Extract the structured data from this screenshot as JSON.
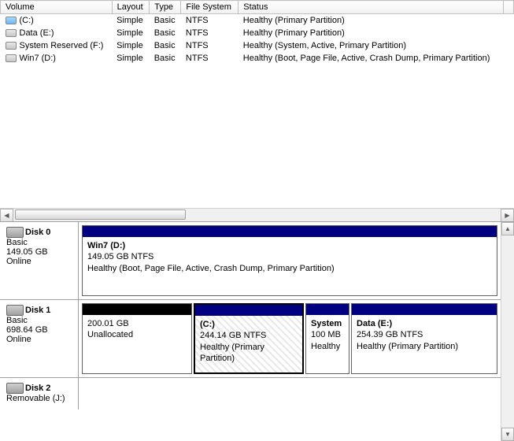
{
  "columns": {
    "c0": "Volume",
    "c1": "Layout",
    "c2": "Type",
    "c3": "File System",
    "c4": "Status"
  },
  "volumes": [
    {
      "name": "(C:)",
      "layout": "Simple",
      "type": "Basic",
      "fs": "NTFS",
      "status": "Healthy (Primary Partition)",
      "iconcls": "c-drv"
    },
    {
      "name": "Data (E:)",
      "layout": "Simple",
      "type": "Basic",
      "fs": "NTFS",
      "status": "Healthy (Primary Partition)",
      "iconcls": ""
    },
    {
      "name": "System Reserved (F:)",
      "layout": "Simple",
      "type": "Basic",
      "fs": "NTFS",
      "status": "Healthy (System, Active, Primary Partition)",
      "iconcls": ""
    },
    {
      "name": "Win7 (D:)",
      "layout": "Simple",
      "type": "Basic",
      "fs": "NTFS",
      "status": "Healthy (Boot, Page File, Active, Crash Dump, Primary Partition)",
      "iconcls": ""
    }
  ],
  "disks": {
    "d0": {
      "title": "Disk 0",
      "type": "Basic",
      "size": "149.05 GB",
      "state": "Online"
    },
    "d1": {
      "title": "Disk 1",
      "type": "Basic",
      "size": "698.64 GB",
      "state": "Online"
    },
    "d2": {
      "title": "Disk 2",
      "type": "Removable (J:)"
    }
  },
  "parts": {
    "p0a": {
      "name": "Win7  (D:)",
      "line2": "149.05 GB NTFS",
      "line3": "Healthy (Boot, Page File, Active, Crash Dump, Primary Partition)"
    },
    "p1a": {
      "name": "",
      "line2": "200.01 GB",
      "line3": "Unallocated"
    },
    "p1b": {
      "name": "(C:)",
      "line2": "244.14 GB NTFS",
      "line3": "Healthy (Primary Partition)"
    },
    "p1c": {
      "name": "System",
      "line2": "100 MB",
      "line3": "Healthy"
    },
    "p1d": {
      "name": "Data  (E:)",
      "line2": "254.39 GB NTFS",
      "line3": "Healthy (Primary Partition)"
    }
  }
}
